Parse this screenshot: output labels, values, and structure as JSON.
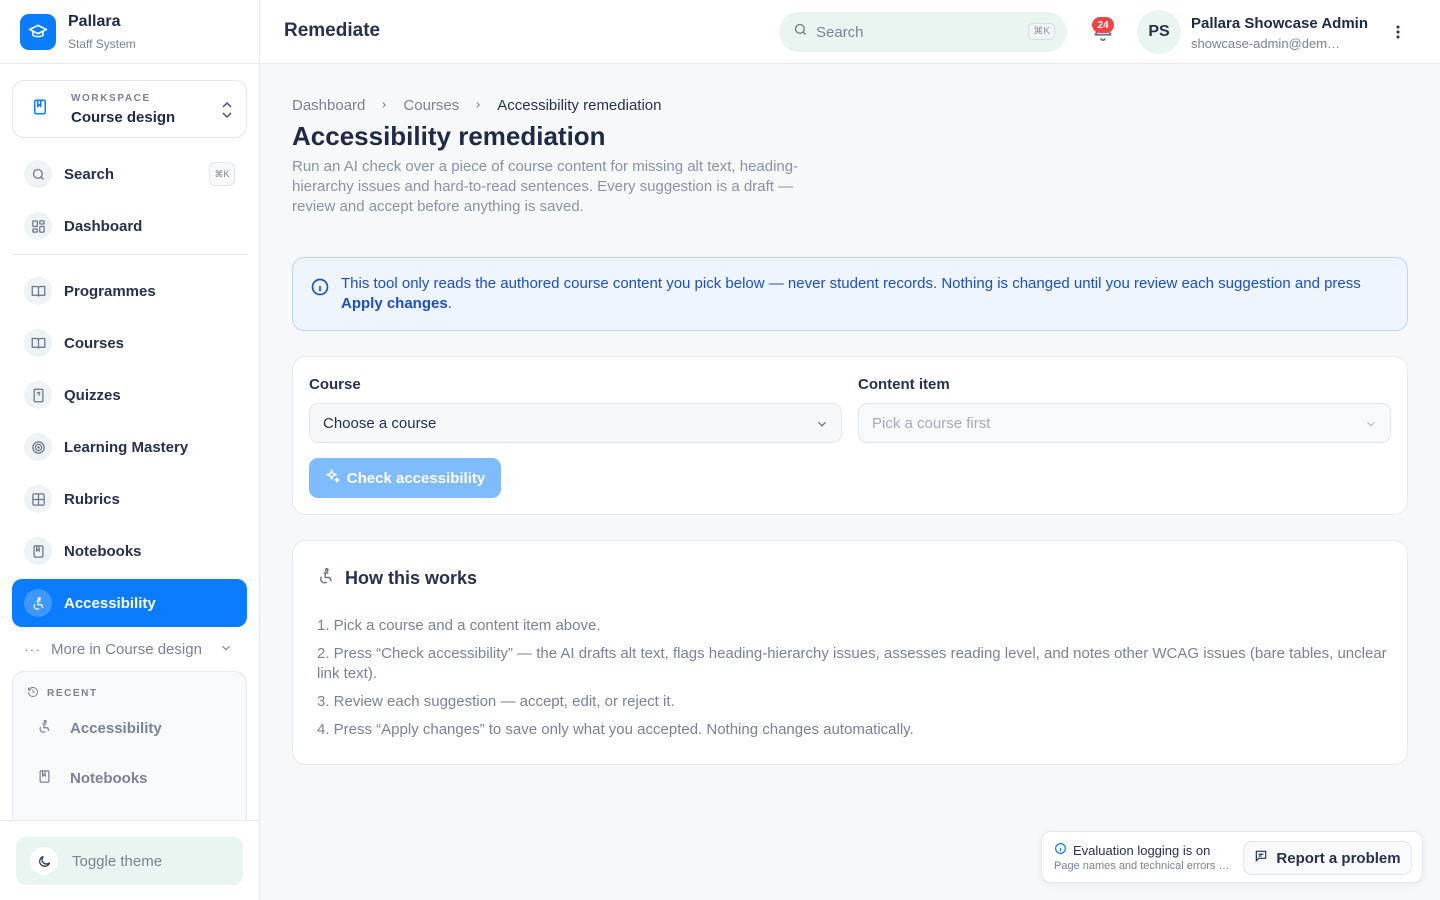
{
  "brand": {
    "name": "Pallara",
    "subtitle": "Staff System"
  },
  "workspace": {
    "label": "WORKSPACE",
    "value": "Course design"
  },
  "sidebar": {
    "search": {
      "label": "Search",
      "shortcut": "⌘K"
    },
    "items": [
      {
        "label": "Dashboard",
        "icon": "grid-icon"
      },
      {
        "label": "Programmes",
        "icon": "book-open-icon"
      },
      {
        "label": "Courses",
        "icon": "book-open-icon"
      },
      {
        "label": "Quizzes",
        "icon": "quiz-icon"
      },
      {
        "label": "Learning Mastery",
        "icon": "target-icon"
      },
      {
        "label": "Rubrics",
        "icon": "table-icon"
      },
      {
        "label": "Notebooks",
        "icon": "notebook-icon"
      },
      {
        "label": "Accessibility",
        "icon": "accessibility-icon",
        "active": true
      }
    ],
    "more": "More in Course design",
    "recent": {
      "label": "RECENT",
      "items": [
        {
          "label": "Accessibility",
          "icon": "accessibility-icon"
        },
        {
          "label": "Notebooks",
          "icon": "notebook-icon"
        }
      ]
    },
    "toggle_theme": "Toggle theme"
  },
  "header": {
    "title": "Remediate",
    "search_placeholder": "Search",
    "search_shortcut": "⌘K",
    "notifications": "24",
    "user": {
      "initials": "PS",
      "name": "Pallara Showcase Admin",
      "email": "showcase-admin@demo.pallara.example"
    }
  },
  "breadcrumb": [
    "Dashboard",
    "Courses",
    "Accessibility remediation"
  ],
  "page": {
    "title": "Accessibility remediation",
    "description": "Run an AI check over a piece of course content for missing alt text, heading-hierarchy issues and hard-to-read sentences. Every suggestion is a draft — review and accept before anything is saved."
  },
  "notice": {
    "text": "This tool only reads the authored course content you pick below — never student records. Nothing is changed until you review each suggestion and press ",
    "emphasis": "Apply changes",
    "end": "."
  },
  "form": {
    "course_label": "Course",
    "course_value": "Choose a course",
    "content_label": "Content item",
    "content_value": "Pick a course first",
    "check_button": "Check accessibility"
  },
  "how": {
    "title": "How this works",
    "steps": [
      "1. Pick a course and a content item above.",
      "2. Press “Check accessibility” — the AI drafts alt text, flags heading-hierarchy issues, assesses reading level, and notes other WCAG issues (bare tables, unclear link text).",
      "3. Review each suggestion — accept, edit, or reject it.",
      "4. Press “Apply changes” to save only what you accepted. Nothing changes automatically."
    ]
  },
  "eval": {
    "title": "Evaluation logging is on",
    "detail": "Page names and technical errors are recorded",
    "report_button": "Report a problem"
  },
  "colors": {
    "accent": "#0a7cff",
    "badge": "#ef4444",
    "notice_text": "#1c4fc4"
  }
}
